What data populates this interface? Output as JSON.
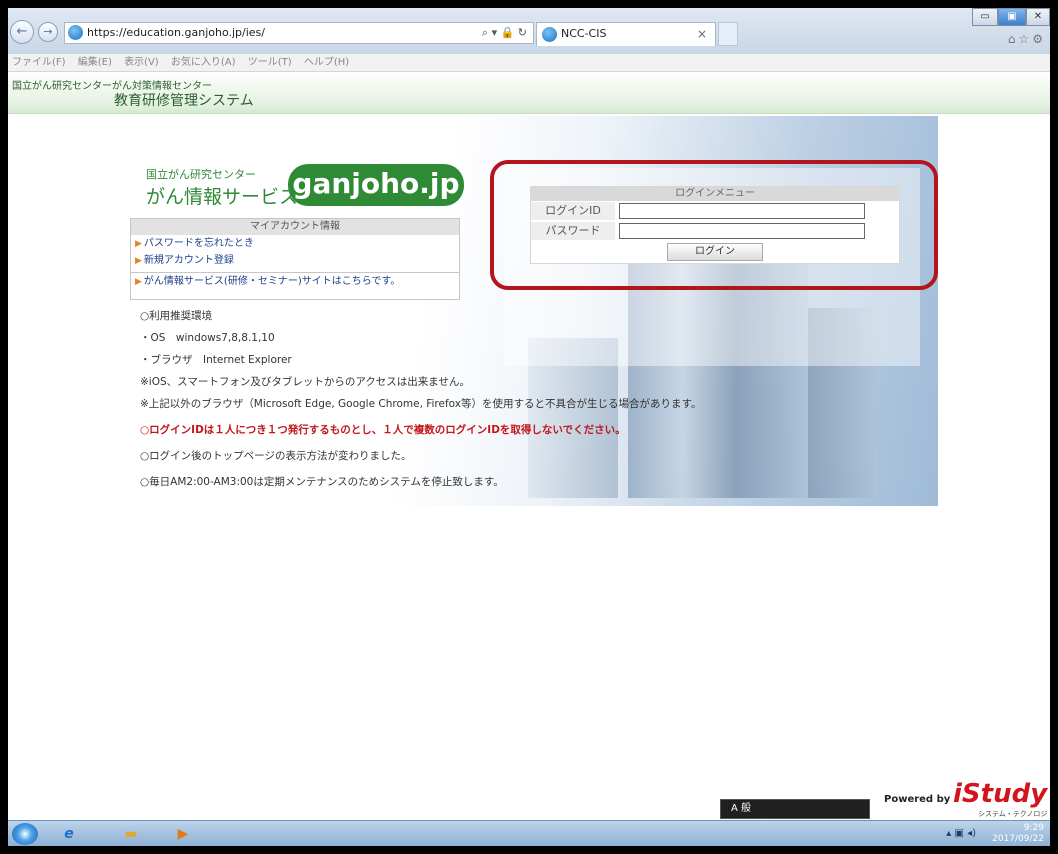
{
  "browser": {
    "url": "https://education.ganjoho.jp/ies/",
    "tab_title": "NCC-CIS",
    "tab_close": "×",
    "url_tools": "",
    "window_minimize": "▭",
    "window_maximize": "▣",
    "window_close": "✕",
    "ie_icons": "⌂☆⚙"
  },
  "menu": {
    "items": [
      "ファイル(F)",
      "編集(E)",
      "表示(V)",
      "お気に入り(A)",
      "ツール(T)",
      "ヘルプ(H)"
    ]
  },
  "header": {
    "org": "国立がん研究センターがん対策情報センター",
    "system": "教育研修管理システム"
  },
  "logo": {
    "small": "国立がん研究センター",
    "big": "がん情報サービス",
    "badge": "ganjoho.jp"
  },
  "account": {
    "title": "マイアカウント情報",
    "links": [
      "パスワードを忘れたとき",
      "新規アカウント登録"
    ],
    "site_link": "がん情報サービス(研修・セミナー)サイトはこちらです。"
  },
  "info": {
    "env_title": "○利用推奨環境",
    "os": "・OS　windows7,8,8.1,10",
    "browser": "・ブラウザ　Internet Explorer",
    "note1": "※iOS、スマートフォン及びタブレットからのアクセスは出来ません。",
    "note2": "※上記以外のブラウザ（Microsoft Edge, Google Chrome, Firefox等）を使用すると不具合が生じる場合があります。",
    "warning": "○ログインIDは１人につき１つ発行するものとし、１人で複数のログインIDを取得しないでください。",
    "notice1": "○ログイン後のトップページの表示方法が変わりました。",
    "notice2": "○毎日AM2:00-AM3:00は定期メンテナンスのためシステムを停止致します。"
  },
  "login": {
    "title": "ログインメニュー",
    "id_label": "ログインID",
    "password_label": "パスワード",
    "button": "ログイン"
  },
  "footer": {
    "ime": "A 般",
    "powered": "Powered by",
    "brand": "iStudy",
    "brand_sub": "システム・テクノロジー・アイ"
  },
  "taskbar": {
    "time": "9:29",
    "date": "2017/09/22",
    "start_icon": "start-orb",
    "ie_glyph": "e",
    "folder_glyph": "▬",
    "media_glyph": "▶"
  },
  "colors": {
    "highlight": "#b4141c",
    "brand_green": "#2f8a36",
    "warning_red": "#c3161c"
  }
}
